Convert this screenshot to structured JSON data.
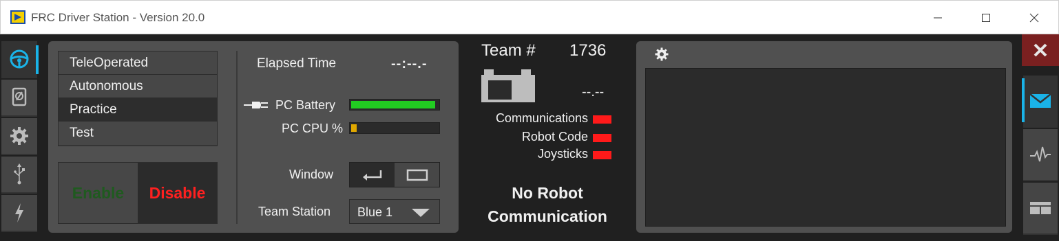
{
  "window": {
    "title": "FRC Driver Station - Version 20.0"
  },
  "left_rail": {
    "items": [
      {
        "icon": "steering-wheel-icon",
        "active": true
      },
      {
        "icon": "diagnostics-icon",
        "active": false
      },
      {
        "icon": "gear-icon",
        "active": false
      },
      {
        "icon": "usb-icon",
        "active": false
      },
      {
        "icon": "power-icon",
        "active": false
      }
    ]
  },
  "modes": {
    "items": [
      "TeleOperated",
      "Autonomous",
      "Practice",
      "Test"
    ],
    "selected": "Practice"
  },
  "controls": {
    "enable_label": "Enable",
    "disable_label": "Disable",
    "enable_color": "#1f5a1f",
    "disable_color": "#ff2020"
  },
  "status": {
    "elapsed_label": "Elapsed Time",
    "elapsed_value": "--:--.-",
    "pc_battery_label": "PC Battery",
    "pc_battery_level": 0.97,
    "pc_battery_color": "#22cc22",
    "pc_cpu_label": "PC CPU %",
    "pc_cpu_level": 0.06,
    "pc_cpu_color": "#e0a800",
    "window_label": "Window",
    "team_station_label": "Team Station",
    "team_station_value": "Blue 1"
  },
  "robot": {
    "team_label": "Team #",
    "team_number": "1736",
    "voltage": "--.--",
    "indicators": [
      {
        "label": "Communications",
        "color": "#ff1a1a"
      },
      {
        "label": "Robot Code",
        "color": "#ff1a1a"
      },
      {
        "label": "Joysticks",
        "color": "#ff1a1a"
      }
    ],
    "message_line1": "No Robot",
    "message_line2": "Communication"
  },
  "right_rail": {
    "items": [
      {
        "icon": "close-icon"
      },
      {
        "icon": "envelope-icon",
        "active": true
      },
      {
        "icon": "waveform-icon",
        "active": false
      },
      {
        "icon": "split-view-icon",
        "active": false
      }
    ]
  },
  "accent_color": "#1ab3e8"
}
